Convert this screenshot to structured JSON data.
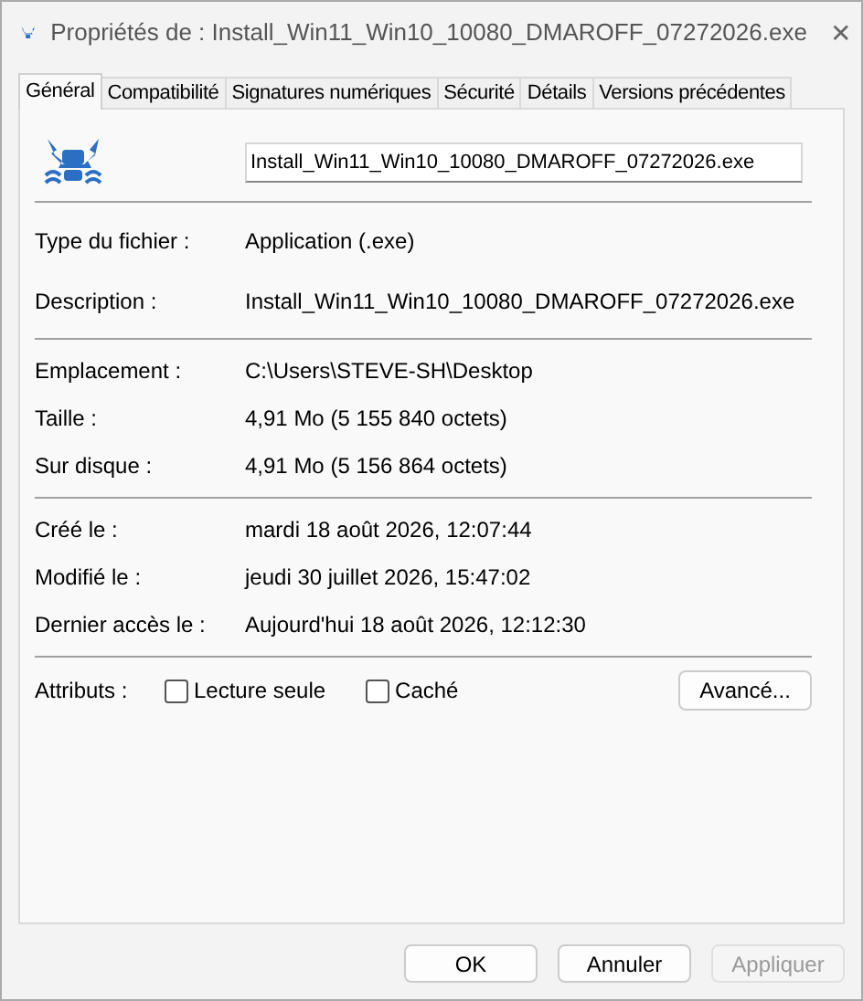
{
  "window": {
    "title": "Propriétés de : Install_Win11_Win10_10080_DMAROFF_07272026.exe",
    "close": "✕"
  },
  "tabs": [
    {
      "label": "Général",
      "selected": true
    },
    {
      "label": "Compatibilité",
      "selected": false
    },
    {
      "label": "Signatures numériques",
      "selected": false
    },
    {
      "label": "Sécurité",
      "selected": false
    },
    {
      "label": "Détails",
      "selected": false
    },
    {
      "label": "Versions précédentes",
      "selected": false
    }
  ],
  "file_name": {
    "value": "Install_Win11_Win10_10080_DMAROFF_07272026.exe"
  },
  "sections": [
    [
      {
        "label": "Type du fichier :",
        "value": "Application (.exe)"
      },
      {
        "label": "Description :",
        "value": "Install_Win11_Win10_10080_DMAROFF_07272026.exe"
      }
    ],
    [
      {
        "label": "Emplacement :",
        "value": "C:\\Users\\STEVE-SH\\Desktop"
      },
      {
        "label": "Taille :",
        "value": "4,91 Mo (5 155 840 octets)"
      },
      {
        "label": "Sur disque :",
        "value": "4,91 Mo (5 156 864 octets)"
      }
    ],
    [
      {
        "label": "Créé le :",
        "value": "mardi 18 août 2026, 12:07:44"
      },
      {
        "label": "Modifié le :",
        "value": "jeudi 30 juillet 2026, 15:47:02"
      },
      {
        "label": "Dernier accès le :",
        "value": "Aujourd'hui 18 août 2026, 12:12:30"
      }
    ]
  ],
  "attributes": {
    "label": "Attributs :",
    "checkboxes": [
      {
        "label": "Lecture seule",
        "checked": false
      },
      {
        "label": "Caché",
        "checked": false
      }
    ],
    "advanced": "Avancé..."
  },
  "buttons": [
    {
      "label": "OK",
      "disabled": false
    },
    {
      "label": "Annuler",
      "disabled": false
    },
    {
      "label": "Appliquer",
      "disabled": true
    }
  ]
}
